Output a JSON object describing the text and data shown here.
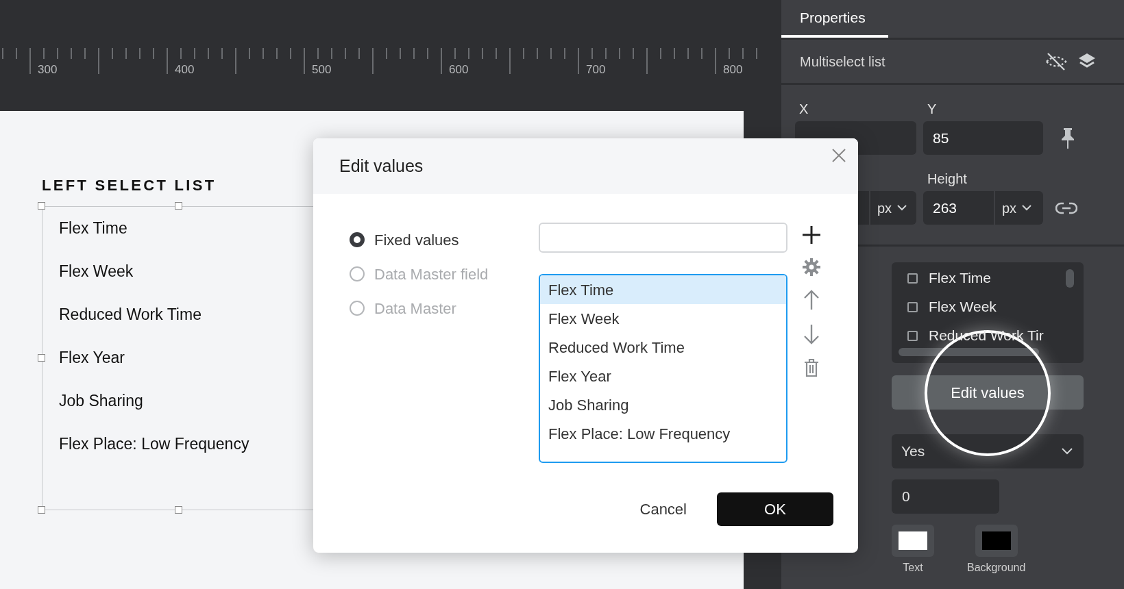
{
  "ruler": {
    "labels": [
      "300",
      "400",
      "500",
      "600",
      "700",
      "800"
    ]
  },
  "canvas": {
    "list_title": "LEFT SELECT LIST",
    "list_items": [
      "Flex Time",
      "Flex Week",
      "Reduced Work Time",
      "Flex Year",
      "Job Sharing",
      "Flex Place: Low Frequency"
    ]
  },
  "dialog": {
    "title": "Edit values",
    "source_options": [
      {
        "label": "Fixed values",
        "selected": true
      },
      {
        "label": "Data Master field",
        "selected": false
      },
      {
        "label": "Data Master",
        "selected": false
      }
    ],
    "values": [
      {
        "label": "Flex Time",
        "selected": true
      },
      {
        "label": "Flex Week",
        "selected": false
      },
      {
        "label": "Reduced Work Time",
        "selected": false
      },
      {
        "label": "Flex Year",
        "selected": false
      },
      {
        "label": "Job Sharing",
        "selected": false
      },
      {
        "label": "Flex Place: Low Frequency",
        "selected": false
      }
    ],
    "cancel_button": "Cancel",
    "ok_button": "OK"
  },
  "properties": {
    "tab": "Properties",
    "element_type": "Multiselect list",
    "x_label": "X",
    "y_label": "Y",
    "y_value": "85",
    "height_label": "Height",
    "height_value": "263",
    "width_unit": "px",
    "height_unit": "px",
    "preview_items": [
      {
        "label": "Flex Time",
        "checked": false
      },
      {
        "label": "Flex Week",
        "checked": false
      },
      {
        "label": "Reduced Work Tir",
        "checked": false
      }
    ],
    "edit_button": "Edit values",
    "dropdown_value": "Yes",
    "number_value": "0",
    "swatches": [
      {
        "label": "Text",
        "color": "#ffffff"
      },
      {
        "label": "Background",
        "color": "#000000"
      }
    ]
  }
}
